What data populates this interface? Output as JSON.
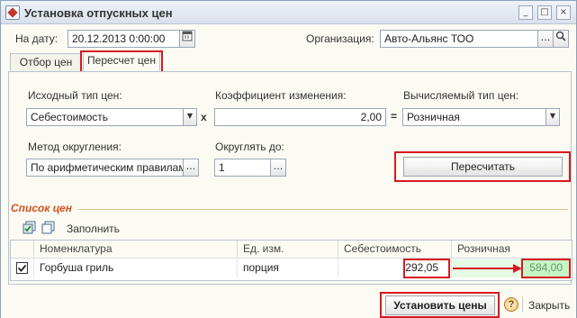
{
  "window": {
    "title": "Установка отпускных цен",
    "controls": {
      "minimize": "_",
      "maximize": "□",
      "close": "×"
    }
  },
  "header": {
    "date_label": "На дату:",
    "date_value": "20.12.2013  0:00:00",
    "org_label": "Организация:",
    "org_value": "Авто-Альянс ТОО",
    "select_glyph": "...",
    "search_glyph": "Q"
  },
  "tabs": [
    {
      "label": "Отбор цен"
    },
    {
      "label": "Пересчет цен"
    }
  ],
  "recalc": {
    "source_label": "Исходный тип цен:",
    "source_value": "Себестоимость",
    "multiply": "x",
    "coef_label": "Коэффициент изменения:",
    "coef_value": "2,00",
    "equals": "=",
    "target_label": "Вычисляемый тип цен:",
    "target_value": "Розничная",
    "round_method_label": "Метод округления:",
    "round_method_value": "По арифметическим правилам",
    "round_to_label": "Округлять до:",
    "round_to_value": "1",
    "recalc_button": "Пересчитать",
    "dropdown_glyph": "▼",
    "select_glyph": "..."
  },
  "price_list": {
    "title": "Список цен",
    "fill_button": "Заполнить",
    "columns": [
      "Номенклатура",
      "Ед. изм.",
      "Себестоимость",
      "Розничная"
    ],
    "rows": [
      {
        "checked": true,
        "item": "Горбуша гриль",
        "unit": "порция",
        "cost": "292,05",
        "retail": "584,00"
      }
    ]
  },
  "footer": {
    "set_prices_button": "Установить цены",
    "help_glyph": "?",
    "close_button": "Закрыть"
  },
  "colors": {
    "highlight_red": "#d71920",
    "retail_cell_green": "#c8f0c8",
    "group_title_orange": "#d8501c"
  }
}
